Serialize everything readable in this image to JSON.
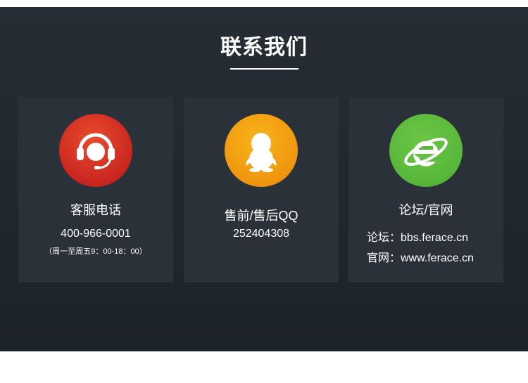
{
  "section": {
    "title": "联系我们"
  },
  "cards": [
    {
      "icon": "headset-icon",
      "color": "#d8342a",
      "label": "客服电话",
      "value": "400-966-0001",
      "note": "（周一至周五9：00-18：00）"
    },
    {
      "icon": "qq-penguin-icon",
      "color": "#f0950f",
      "label": "售前/售后QQ",
      "value": "252404308"
    },
    {
      "icon": "internet-explorer-icon",
      "color": "#57b73a",
      "label": "论坛/官网",
      "lines": [
        "论坛：bbs.ferace.cn",
        "官网：www.ferace.cn"
      ]
    }
  ]
}
